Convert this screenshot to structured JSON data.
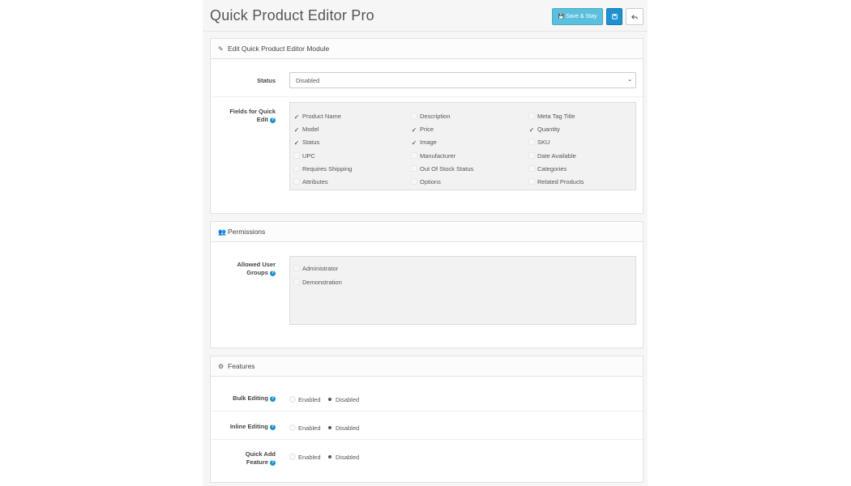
{
  "header": {
    "title": "Quick Product Editor Pro",
    "save_stay_label": "Save & Stay",
    "save_icon": "floppy-disk-icon",
    "back_icon": "reply-arrow-icon"
  },
  "edit_panel": {
    "title": "Edit Quick Product Editor Module",
    "status_label": "Status",
    "status_value": "Disabled",
    "fields_label_1": "Fields for Quick",
    "fields_label_2": "Edit",
    "fields": [
      {
        "label": "Product Name",
        "checked": true
      },
      {
        "label": "Description",
        "checked": false
      },
      {
        "label": "Meta Tag Title",
        "checked": false
      },
      {
        "label": "Model",
        "checked": true
      },
      {
        "label": "Price",
        "checked": true
      },
      {
        "label": "Quantity",
        "checked": true
      },
      {
        "label": "Status",
        "checked": true
      },
      {
        "label": "Image",
        "checked": true
      },
      {
        "label": "SKU",
        "checked": false
      },
      {
        "label": "UPC",
        "checked": false
      },
      {
        "label": "Manufacturer",
        "checked": false
      },
      {
        "label": "Date Available",
        "checked": false
      },
      {
        "label": "Requires Shipping",
        "checked": false
      },
      {
        "label": "Out Of Stock Status",
        "checked": false
      },
      {
        "label": "Categories",
        "checked": false
      },
      {
        "label": "Attributes",
        "checked": false
      },
      {
        "label": "Options",
        "checked": false
      },
      {
        "label": "Related Products",
        "checked": false
      }
    ]
  },
  "permissions_panel": {
    "title": "Permissions",
    "groups_label_1": "Allowed User",
    "groups_label_2": "Groups",
    "groups": [
      {
        "label": "Administrator",
        "checked": false
      },
      {
        "label": "Demonstration",
        "checked": false
      }
    ]
  },
  "features_panel": {
    "title": "Features",
    "features": [
      {
        "label_1": "Bulk Editing",
        "label_2": "",
        "enabled_label": "Enabled",
        "disabled_label": "Disabled",
        "value": "Disabled"
      },
      {
        "label_1": "Inline Editing",
        "label_2": "",
        "enabled_label": "Enabled",
        "disabled_label": "Disabled",
        "value": "Disabled"
      },
      {
        "label_1": "Quick Add",
        "label_2": "Feature",
        "enabled_label": "Enabled",
        "disabled_label": "Disabled",
        "value": "Disabled"
      }
    ]
  }
}
